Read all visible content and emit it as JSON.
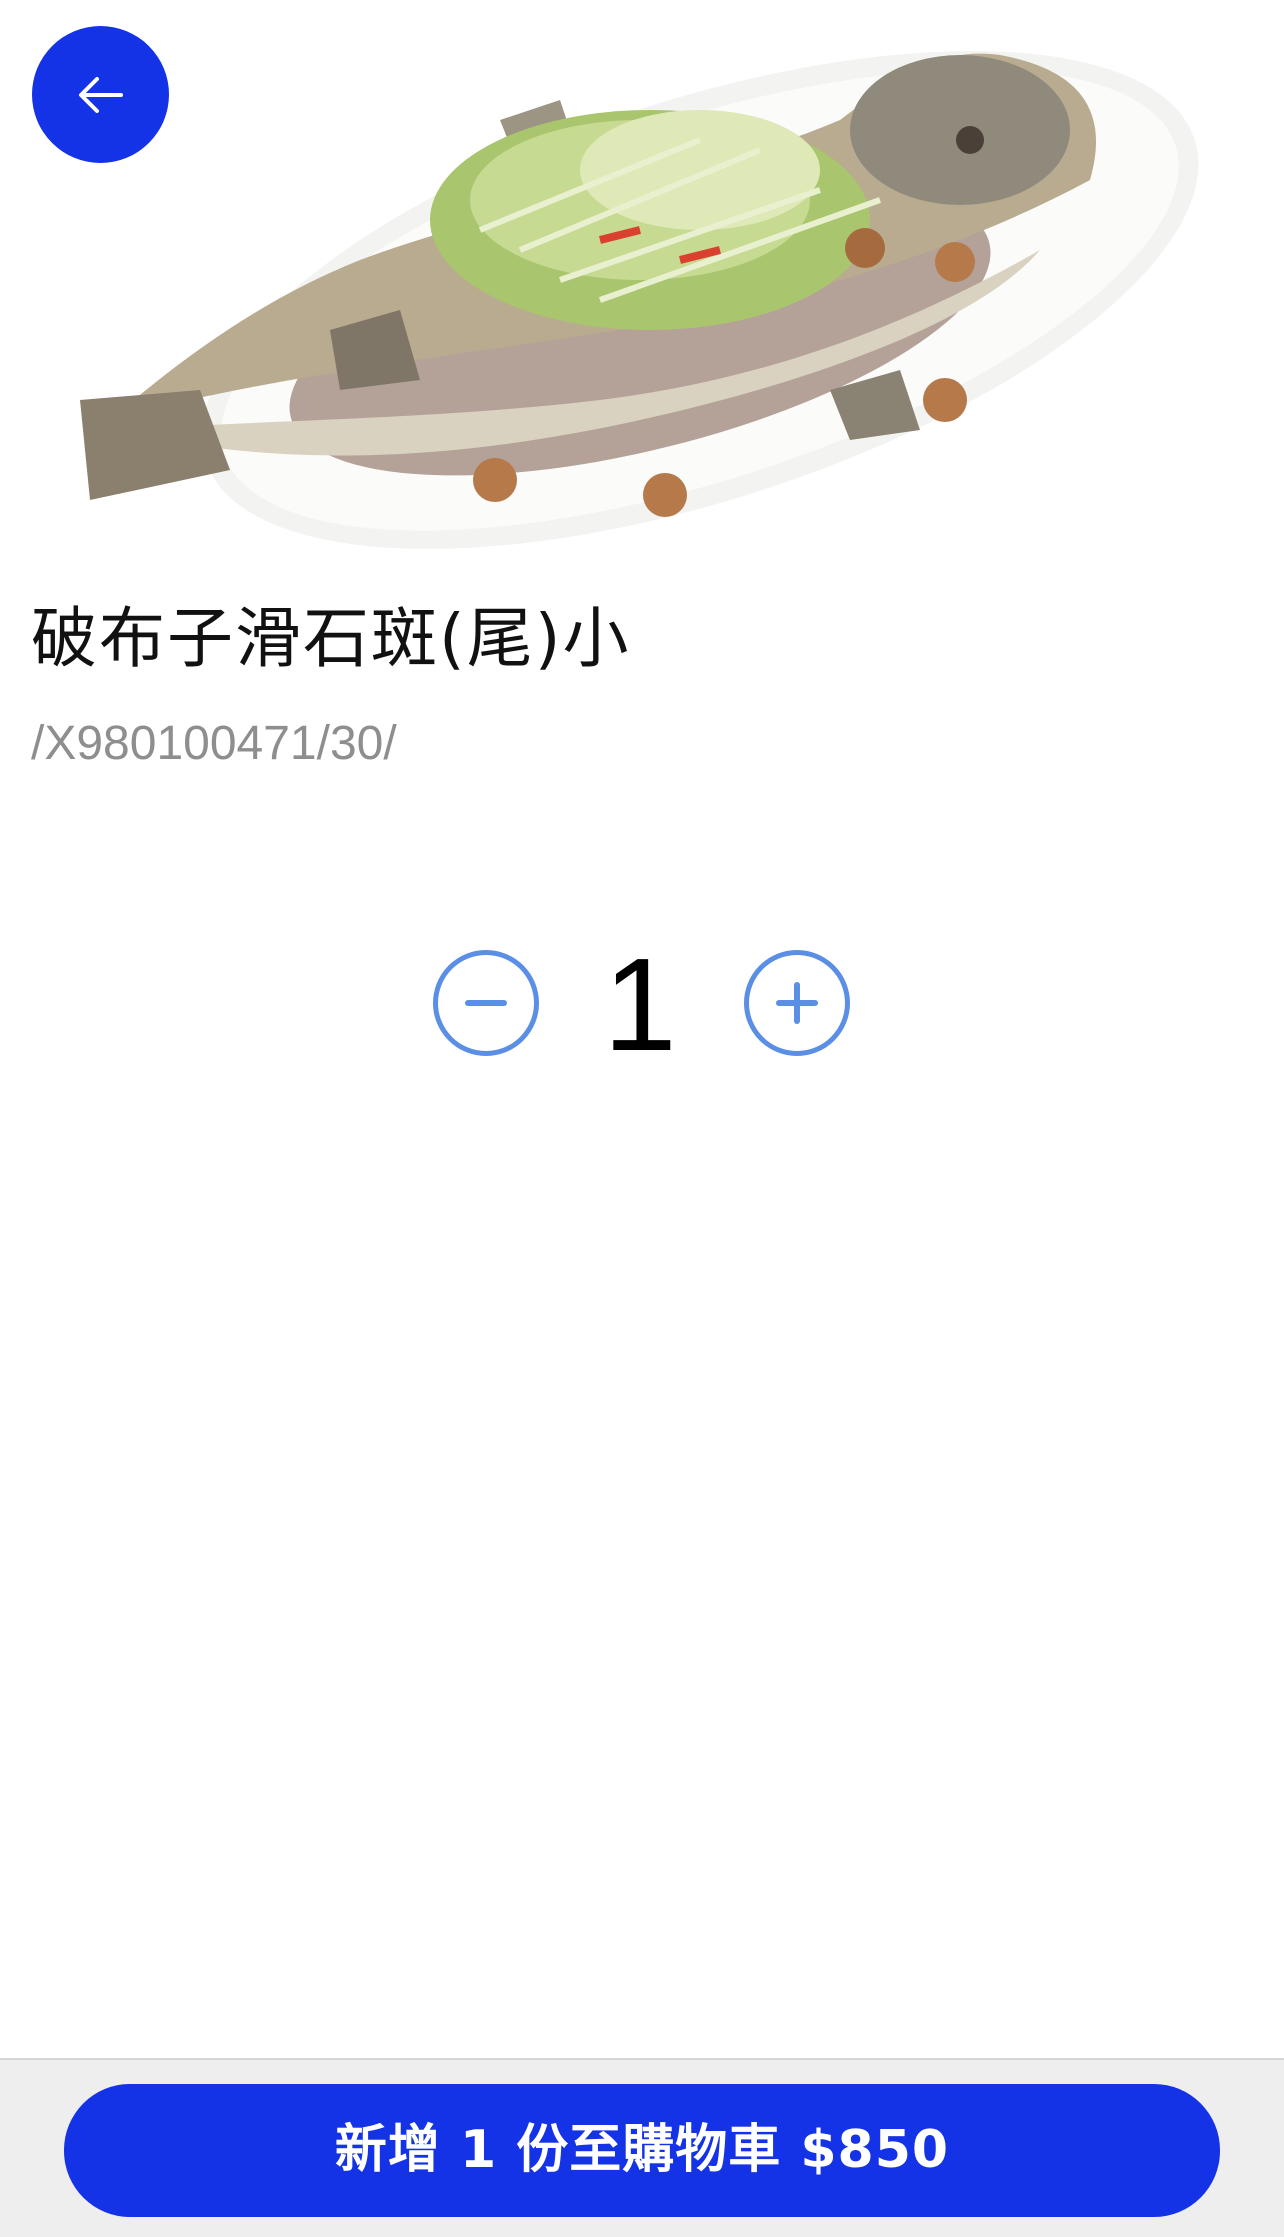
{
  "product": {
    "image_icon": "steamed-fish-dish-image",
    "name": "破布子滑石斑(尾)小",
    "sku": "/X980100471/30/"
  },
  "quantity": {
    "value": "1"
  },
  "cart_button": {
    "label": "新增 1 份至購物車 $850"
  },
  "colors": {
    "accent": "#1432e6",
    "stepper": "#5b8fe6"
  }
}
